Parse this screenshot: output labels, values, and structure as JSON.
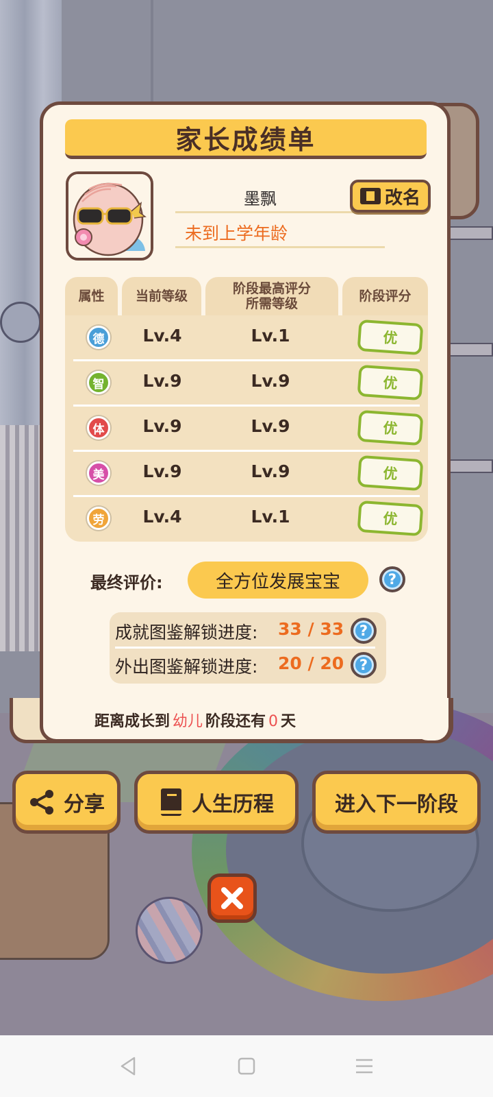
{
  "report": {
    "title": "家长成绩单",
    "child_name": "墨飘",
    "status": "未到上学年龄",
    "rename_label": "改名"
  },
  "table": {
    "headers": [
      "属性",
      "当前等级",
      "阶段最高评分\n所需等级",
      "阶段评分"
    ],
    "rows": [
      {
        "attr": "德",
        "color": "#4a9fd8",
        "current": "Lv.4",
        "required": "Lv.1",
        "grade": "优"
      },
      {
        "attr": "智",
        "color": "#74b32f",
        "current": "Lv.9",
        "required": "Lv.9",
        "grade": "优"
      },
      {
        "attr": "体",
        "color": "#e24a4a",
        "current": "Lv.9",
        "required": "Lv.9",
        "grade": "优"
      },
      {
        "attr": "美",
        "color": "#d64fa8",
        "current": "Lv.9",
        "required": "Lv.9",
        "grade": "优"
      },
      {
        "attr": "劳",
        "color": "#f0a53a",
        "current": "Lv.4",
        "required": "Lv.1",
        "grade": "优"
      }
    ]
  },
  "final": {
    "label": "最终评价:",
    "value": "全方位发展宝宝"
  },
  "progress": {
    "achievement_label": "成就图鉴解锁进度:",
    "achievement_value": "33 / 33",
    "outing_label": "外出图鉴解锁进度:",
    "outing_value": "20 / 20"
  },
  "footer": {
    "prefix": "距离成长到",
    "stage": "幼儿",
    "middle": "阶段还有",
    "days": "0",
    "suffix": "天"
  },
  "actions": {
    "share": "分享",
    "history": "人生历程",
    "next_stage": "进入下一阶段"
  },
  "help_glyph": "?",
  "colors": {
    "accent": "#fbc94f",
    "border": "#6e4a3f",
    "highlight": "#ec6b1f",
    "grade_green": "#8cb630",
    "close_red": "#e8531a"
  }
}
